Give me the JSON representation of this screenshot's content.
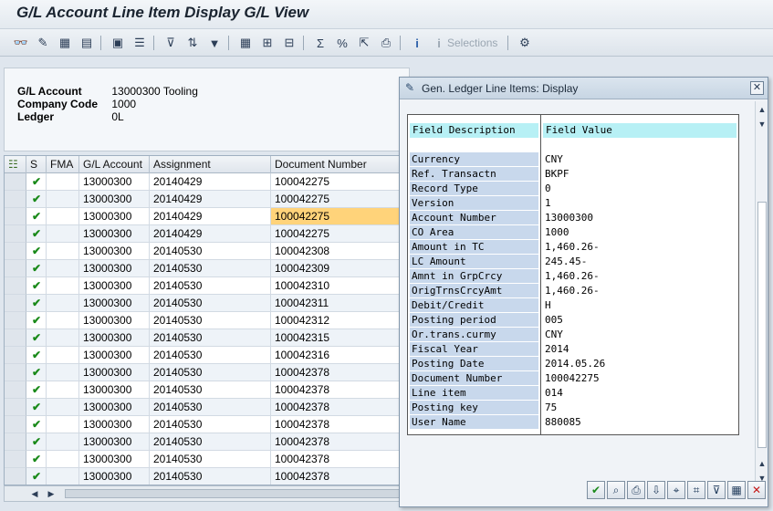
{
  "window": {
    "title": "G/L Account Line Item Display G/L View"
  },
  "toolbar": {
    "buttons": [
      {
        "icon": "glasses-icon",
        "glyph": "👓"
      },
      {
        "icon": "pencil-icon",
        "glyph": "✎"
      },
      {
        "icon": "grid-icon",
        "glyph": "▦"
      },
      {
        "icon": "document-icon",
        "glyph": "▤"
      },
      {
        "icon": "document-details-icon",
        "glyph": "▣"
      },
      {
        "icon": "list-icon",
        "glyph": "☰"
      },
      {
        "icon": "filter-icon",
        "glyph": "⊽"
      },
      {
        "icon": "sort-icon",
        "glyph": "⇅"
      },
      {
        "icon": "filter-set-icon",
        "glyph": "▼"
      },
      {
        "icon": "layout-icon",
        "glyph": "▦"
      },
      {
        "icon": "layout-change-icon",
        "glyph": "⊞"
      },
      {
        "icon": "layout-save-icon",
        "glyph": "⊟"
      },
      {
        "icon": "sum-icon",
        "glyph": "Σ"
      },
      {
        "icon": "subtotal-icon",
        "glyph": "%"
      },
      {
        "icon": "export-icon",
        "glyph": "⇱"
      },
      {
        "icon": "print-icon",
        "glyph": "⎙"
      },
      {
        "icon": "info-icon",
        "glyph": "i"
      },
      {
        "icon": "selections-icon",
        "glyph": "i"
      },
      {
        "icon": "settings-icon",
        "glyph": "⚙"
      }
    ],
    "selections_label": "Selections"
  },
  "header": {
    "gl_account_label": "G/L Account",
    "gl_account_value": "13000300 Tooling",
    "company_code_label": "Company Code",
    "company_code_value": "1000",
    "ledger_label": "Ledger",
    "ledger_value": "0L"
  },
  "grid": {
    "columns": [
      "S",
      "FMA",
      "G/L Account",
      "Assignment",
      "Document Number"
    ],
    "rows": [
      {
        "gl": "13000300",
        "assignment": "20140429",
        "doc": "100042275"
      },
      {
        "gl": "13000300",
        "assignment": "20140429",
        "doc": "100042275"
      },
      {
        "gl": "13000300",
        "assignment": "20140429",
        "doc": "100042275"
      },
      {
        "gl": "13000300",
        "assignment": "20140429",
        "doc": "100042275"
      },
      {
        "gl": "13000300",
        "assignment": "20140530",
        "doc": "100042308"
      },
      {
        "gl": "13000300",
        "assignment": "20140530",
        "doc": "100042309"
      },
      {
        "gl": "13000300",
        "assignment": "20140530",
        "doc": "100042310"
      },
      {
        "gl": "13000300",
        "assignment": "20140530",
        "doc": "100042311"
      },
      {
        "gl": "13000300",
        "assignment": "20140530",
        "doc": "100042312"
      },
      {
        "gl": "13000300",
        "assignment": "20140530",
        "doc": "100042315"
      },
      {
        "gl": "13000300",
        "assignment": "20140530",
        "doc": "100042316"
      },
      {
        "gl": "13000300",
        "assignment": "20140530",
        "doc": "100042378"
      },
      {
        "gl": "13000300",
        "assignment": "20140530",
        "doc": "100042378"
      },
      {
        "gl": "13000300",
        "assignment": "20140530",
        "doc": "100042378"
      },
      {
        "gl": "13000300",
        "assignment": "20140530",
        "doc": "100042378"
      },
      {
        "gl": "13000300",
        "assignment": "20140530",
        "doc": "100042378"
      },
      {
        "gl": "13000300",
        "assignment": "20140530",
        "doc": "100042378"
      },
      {
        "gl": "13000300",
        "assignment": "20140530",
        "doc": "100042378"
      }
    ],
    "status_glyph": "✔",
    "highlighted_row": 2,
    "highlight_color": "#ffd37a"
  },
  "dialog": {
    "title": "Gen. Ledger Line Items: Display",
    "close_glyph": "✕",
    "header_description": "Field Description",
    "header_value": "Field Value",
    "fields": [
      {
        "desc": "Currency",
        "value": "CNY"
      },
      {
        "desc": "Ref. Transactn",
        "value": "BKPF"
      },
      {
        "desc": "Record Type",
        "value": "0"
      },
      {
        "desc": "Version",
        "value": "1"
      },
      {
        "desc": "Account Number",
        "value": "13000300"
      },
      {
        "desc": "CO Area",
        "value": "1000"
      },
      {
        "desc": "Amount in TC",
        "value": "1,460.26-"
      },
      {
        "desc": "LC Amount",
        "value": "245.45-"
      },
      {
        "desc": "Amnt in GrpCrcy",
        "value": "1,460.26-"
      },
      {
        "desc": "OrigTrnsCrcyAmt",
        "value": "1,460.26-"
      },
      {
        "desc": "Debit/Credit",
        "value": "H"
      },
      {
        "desc": "Posting period",
        "value": "005"
      },
      {
        "desc": "Or.trans.curmy",
        "value": "CNY"
      },
      {
        "desc": "Fiscal Year",
        "value": "2014"
      },
      {
        "desc": "Posting Date",
        "value": "2014.05.26"
      },
      {
        "desc": "Document Number",
        "value": "100042275"
      },
      {
        "desc": "Line item",
        "value": "014"
      },
      {
        "desc": "Posting key",
        "value": "75"
      },
      {
        "desc": "User Name",
        "value": "880085"
      }
    ],
    "footer_buttons": [
      {
        "icon": "confirm-icon",
        "glyph": "✔"
      },
      {
        "icon": "find-icon",
        "glyph": "⌕"
      },
      {
        "icon": "print-icon",
        "glyph": "⎙"
      },
      {
        "icon": "download-icon",
        "glyph": "⇩"
      },
      {
        "icon": "find-next-icon",
        "glyph": "⌖"
      },
      {
        "icon": "find-all-icon",
        "glyph": "⌗"
      },
      {
        "icon": "filter-icon",
        "glyph": "⊽"
      },
      {
        "icon": "layout-icon",
        "glyph": "▦"
      },
      {
        "icon": "cancel-icon",
        "glyph": "✕"
      }
    ]
  }
}
